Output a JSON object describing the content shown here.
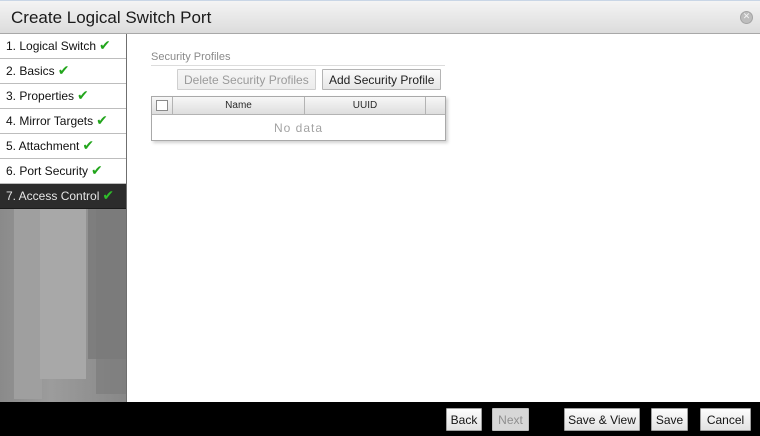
{
  "dialog": {
    "title": "Create Logical Switch Port"
  },
  "icons": {
    "close": "close-circle-icon",
    "check": "checkmark-icon",
    "check_color": "#22a51c"
  },
  "steps": [
    {
      "label": "1. Logical Switch",
      "done": true
    },
    {
      "label": "2. Basics",
      "done": true
    },
    {
      "label": "3. Properties",
      "done": true
    },
    {
      "label": "4. Mirror Targets",
      "done": true
    },
    {
      "label": "5. Attachment",
      "done": true
    },
    {
      "label": "6. Port Security",
      "done": true
    },
    {
      "label": "7. Access Control",
      "done": true,
      "active": true
    }
  ],
  "security": {
    "section_label": "Security Profiles",
    "delete_label": "Delete Security Profiles",
    "add_label": "Add Security Profile",
    "columns": [
      "Name",
      "UUID"
    ],
    "empty_text": "No data"
  },
  "footer": {
    "back": "Back",
    "next": "Next",
    "save_view": "Save & View",
    "save": "Save",
    "cancel": "Cancel"
  }
}
